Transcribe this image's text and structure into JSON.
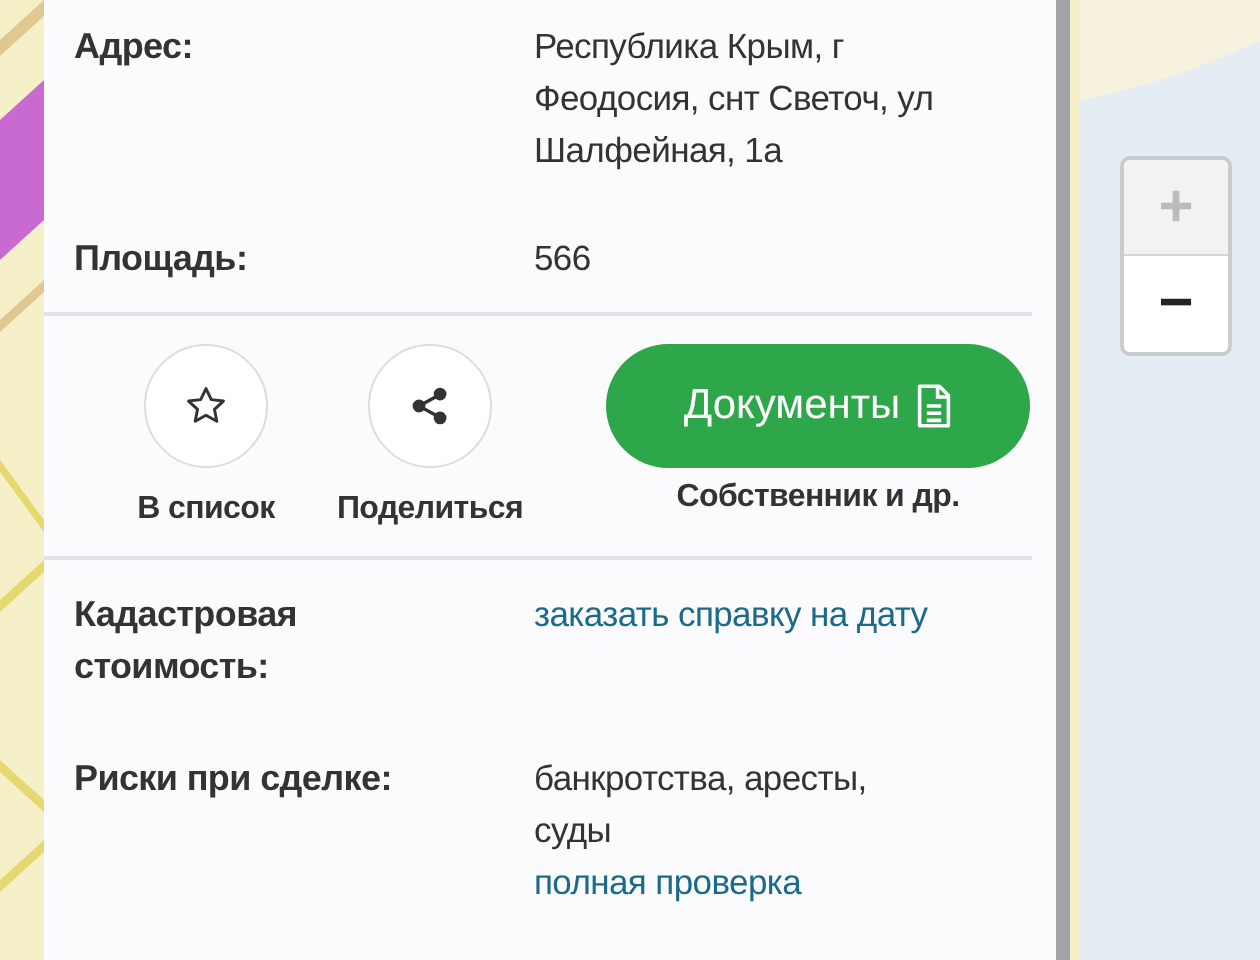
{
  "details_top": [
    {
      "label": "Адрес:",
      "value": "Республика Крым, г Феодосия, снт Светоч, ул Шалфейная, 1а"
    },
    {
      "label": "Площадь:",
      "value": "566"
    }
  ],
  "actions": [
    {
      "kind": "favorite",
      "label": "В список"
    },
    {
      "kind": "share",
      "label": "Поделиться"
    }
  ],
  "documents_button": {
    "label": "Документы",
    "caption": "Собственник и др."
  },
  "details_bottom": [
    {
      "label": "Кадастровая стоимость:",
      "parts": [
        {
          "kind": "link",
          "text": "заказать справку на дату"
        }
      ]
    },
    {
      "label": "Риски при сделке:",
      "parts": [
        {
          "kind": "text",
          "text": "банкротства, аресты, суды"
        },
        {
          "kind": "link",
          "text": "полная проверка"
        }
      ]
    }
  ],
  "map_controls": [
    {
      "label": "+",
      "disabled": true
    },
    {
      "label": "−",
      "disabled": false
    }
  ]
}
